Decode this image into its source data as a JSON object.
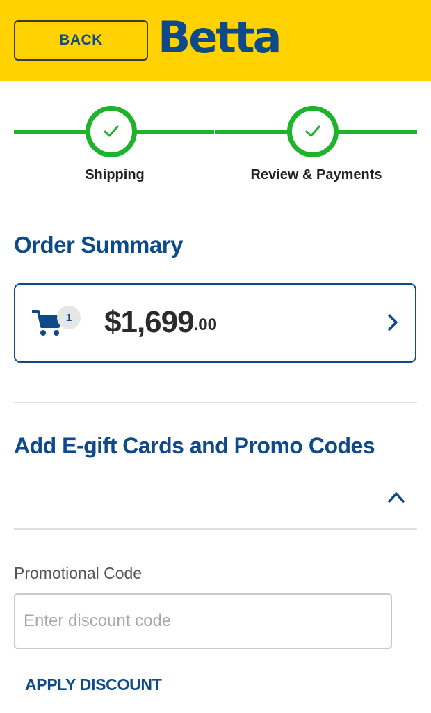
{
  "header": {
    "back_label": "BACK",
    "logo_text": "Betta",
    "background_color": "#FFD200",
    "brand_color": "#0E4A8A"
  },
  "stepper": {
    "accent_color": "#1DB32A",
    "steps": [
      {
        "label": "Shipping",
        "status": "complete",
        "icon": "checkmark-icon"
      },
      {
        "label": "Review & Payments",
        "status": "complete",
        "icon": "checkmark-icon"
      }
    ]
  },
  "order_summary": {
    "title": "Order Summary",
    "cart_count": "1",
    "cart_icon": "shopping-cart-icon",
    "price_main": "$1,699",
    "price_cents": ".00",
    "expand_icon": "chevron-right-icon"
  },
  "promo_section": {
    "title": "Add E-gift Cards and Promo Codes",
    "toggle_icon": "chevron-up-icon",
    "field_label": "Promotional Code",
    "input_value": "",
    "input_placeholder": "Enter discount code",
    "apply_label": "APPLY DISCOUNT"
  }
}
